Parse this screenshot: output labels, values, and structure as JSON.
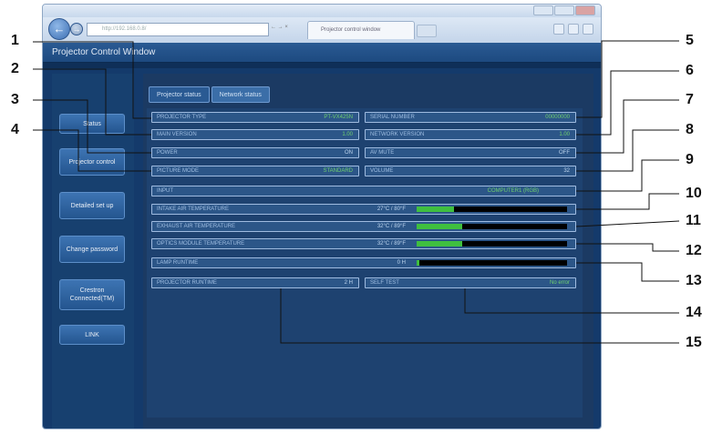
{
  "browser": {
    "address": "http://192.168.0.8/",
    "address_controls": "← → ×",
    "tab_title": "Projector control window",
    "nav_back": "←",
    "nav_forward": "→"
  },
  "page": {
    "title": "Projector Control Window"
  },
  "sidebar": {
    "items": [
      {
        "label": "Status"
      },
      {
        "label": "Projector control"
      },
      {
        "label": "Detailed set up"
      },
      {
        "label": "Change password"
      },
      {
        "label": "Crestron Connected(TM)"
      },
      {
        "label": "LINK"
      }
    ]
  },
  "tabs": [
    {
      "label": "Projector status"
    },
    {
      "label": "Network status"
    }
  ],
  "fields": {
    "projector_type": {
      "label": "PROJECTOR TYPE",
      "value": "PT-VX425N"
    },
    "main_version": {
      "label": "MAIN VERSION",
      "value": "1.00"
    },
    "power": {
      "label": "POWER",
      "value": "ON"
    },
    "picture_mode": {
      "label": "PICTURE MODE",
      "value": "STANDARD"
    },
    "serial_number": {
      "label": "SERIAL NUMBER",
      "value": "00000000"
    },
    "network_version": {
      "label": "NETWORK VERSION",
      "value": "1.00"
    },
    "av_mute": {
      "label": "AV MUTE",
      "value": "OFF"
    },
    "volume": {
      "label": "VOLUME",
      "value": "32"
    },
    "input": {
      "label": "INPUT",
      "value": "COMPUTER1 (RGB)"
    },
    "intake_air_temp": {
      "label": "INTAKE AIR TEMPERATURE",
      "value": "27°C / 80°F",
      "level": 0.25
    },
    "exhaust_air_temp": {
      "label": "EXHAUST AIR TEMPERATURE",
      "value": "32°C / 89°F",
      "level": 0.3
    },
    "optics_temp": {
      "label": "OPTICS MODULE TEMPERATURE",
      "value": "32°C / 89°F",
      "level": 0.3
    },
    "lamp_runtime": {
      "label": "LAMP RUNTIME",
      "value": "0 H",
      "level": 0.02
    },
    "projector_runtime": {
      "label": "PROJECTOR RUNTIME",
      "value": "2 H"
    },
    "self_test": {
      "label": "SELF TEST",
      "value": "No error"
    }
  },
  "callouts": [
    "1",
    "2",
    "3",
    "4",
    "5",
    "6",
    "7",
    "8",
    "9",
    "10",
    "11",
    "12",
    "13",
    "14",
    "15"
  ],
  "colors": {
    "bar_fill": "#3fbf3f",
    "value_text": "#6fd06f",
    "page_bg": "#143a6b"
  }
}
